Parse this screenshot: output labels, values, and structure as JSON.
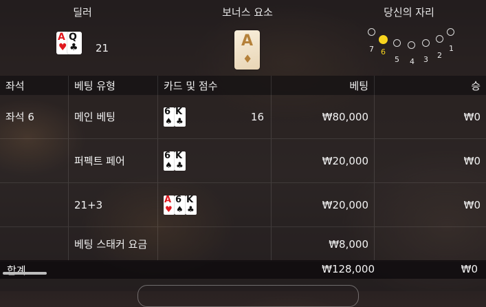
{
  "headers": {
    "dealer": "딜러",
    "bonus": "보너스 요소",
    "your_seat": "당신의 자리"
  },
  "dealer": {
    "cards": [
      {
        "rank": "A",
        "suit": "♥",
        "color": "red"
      },
      {
        "rank": "Q",
        "suit": "♣",
        "color": "black"
      }
    ],
    "score": "21"
  },
  "bonus_card": {
    "rank": "A",
    "suit": "♦"
  },
  "seats": [
    {
      "num": "7",
      "active": false
    },
    {
      "num": "6",
      "active": true
    },
    {
      "num": "5",
      "active": false
    },
    {
      "num": "4",
      "active": false
    },
    {
      "num": "3",
      "active": false
    },
    {
      "num": "2",
      "active": false
    },
    {
      "num": "1",
      "active": false
    }
  ],
  "table": {
    "columns": [
      "좌석",
      "베팅 유형",
      "카드 및 점수",
      "베팅",
      "승"
    ],
    "rows": [
      {
        "seat": "좌석 6",
        "type": "메인 베팅",
        "cards": [
          {
            "rank": "6",
            "suit": "♠",
            "color": "black"
          },
          {
            "rank": "K",
            "suit": "♣",
            "color": "black"
          }
        ],
        "score": "16",
        "bet": "₩80,000",
        "win": "₩0"
      },
      {
        "seat": "",
        "type": "퍼펙트 페어",
        "cards": [
          {
            "rank": "6",
            "suit": "♠",
            "color": "black"
          },
          {
            "rank": "K",
            "suit": "♣",
            "color": "black"
          }
        ],
        "score": "",
        "bet": "₩20,000",
        "win": "₩0"
      },
      {
        "seat": "",
        "type": "21+3",
        "cards": [
          {
            "rank": "A",
            "suit": "♥",
            "color": "red"
          },
          {
            "rank": "6",
            "suit": "♠",
            "color": "black"
          },
          {
            "rank": "K",
            "suit": "♣",
            "color": "black"
          }
        ],
        "score": "",
        "bet": "₩20,000",
        "win": "₩0"
      },
      {
        "seat": "",
        "type": "베팅 스태커 요금",
        "cards": [],
        "score": "",
        "bet": "₩8,000",
        "win": ""
      }
    ]
  },
  "total": {
    "label": "합계",
    "bet": "₩128,000",
    "win": "₩0"
  }
}
